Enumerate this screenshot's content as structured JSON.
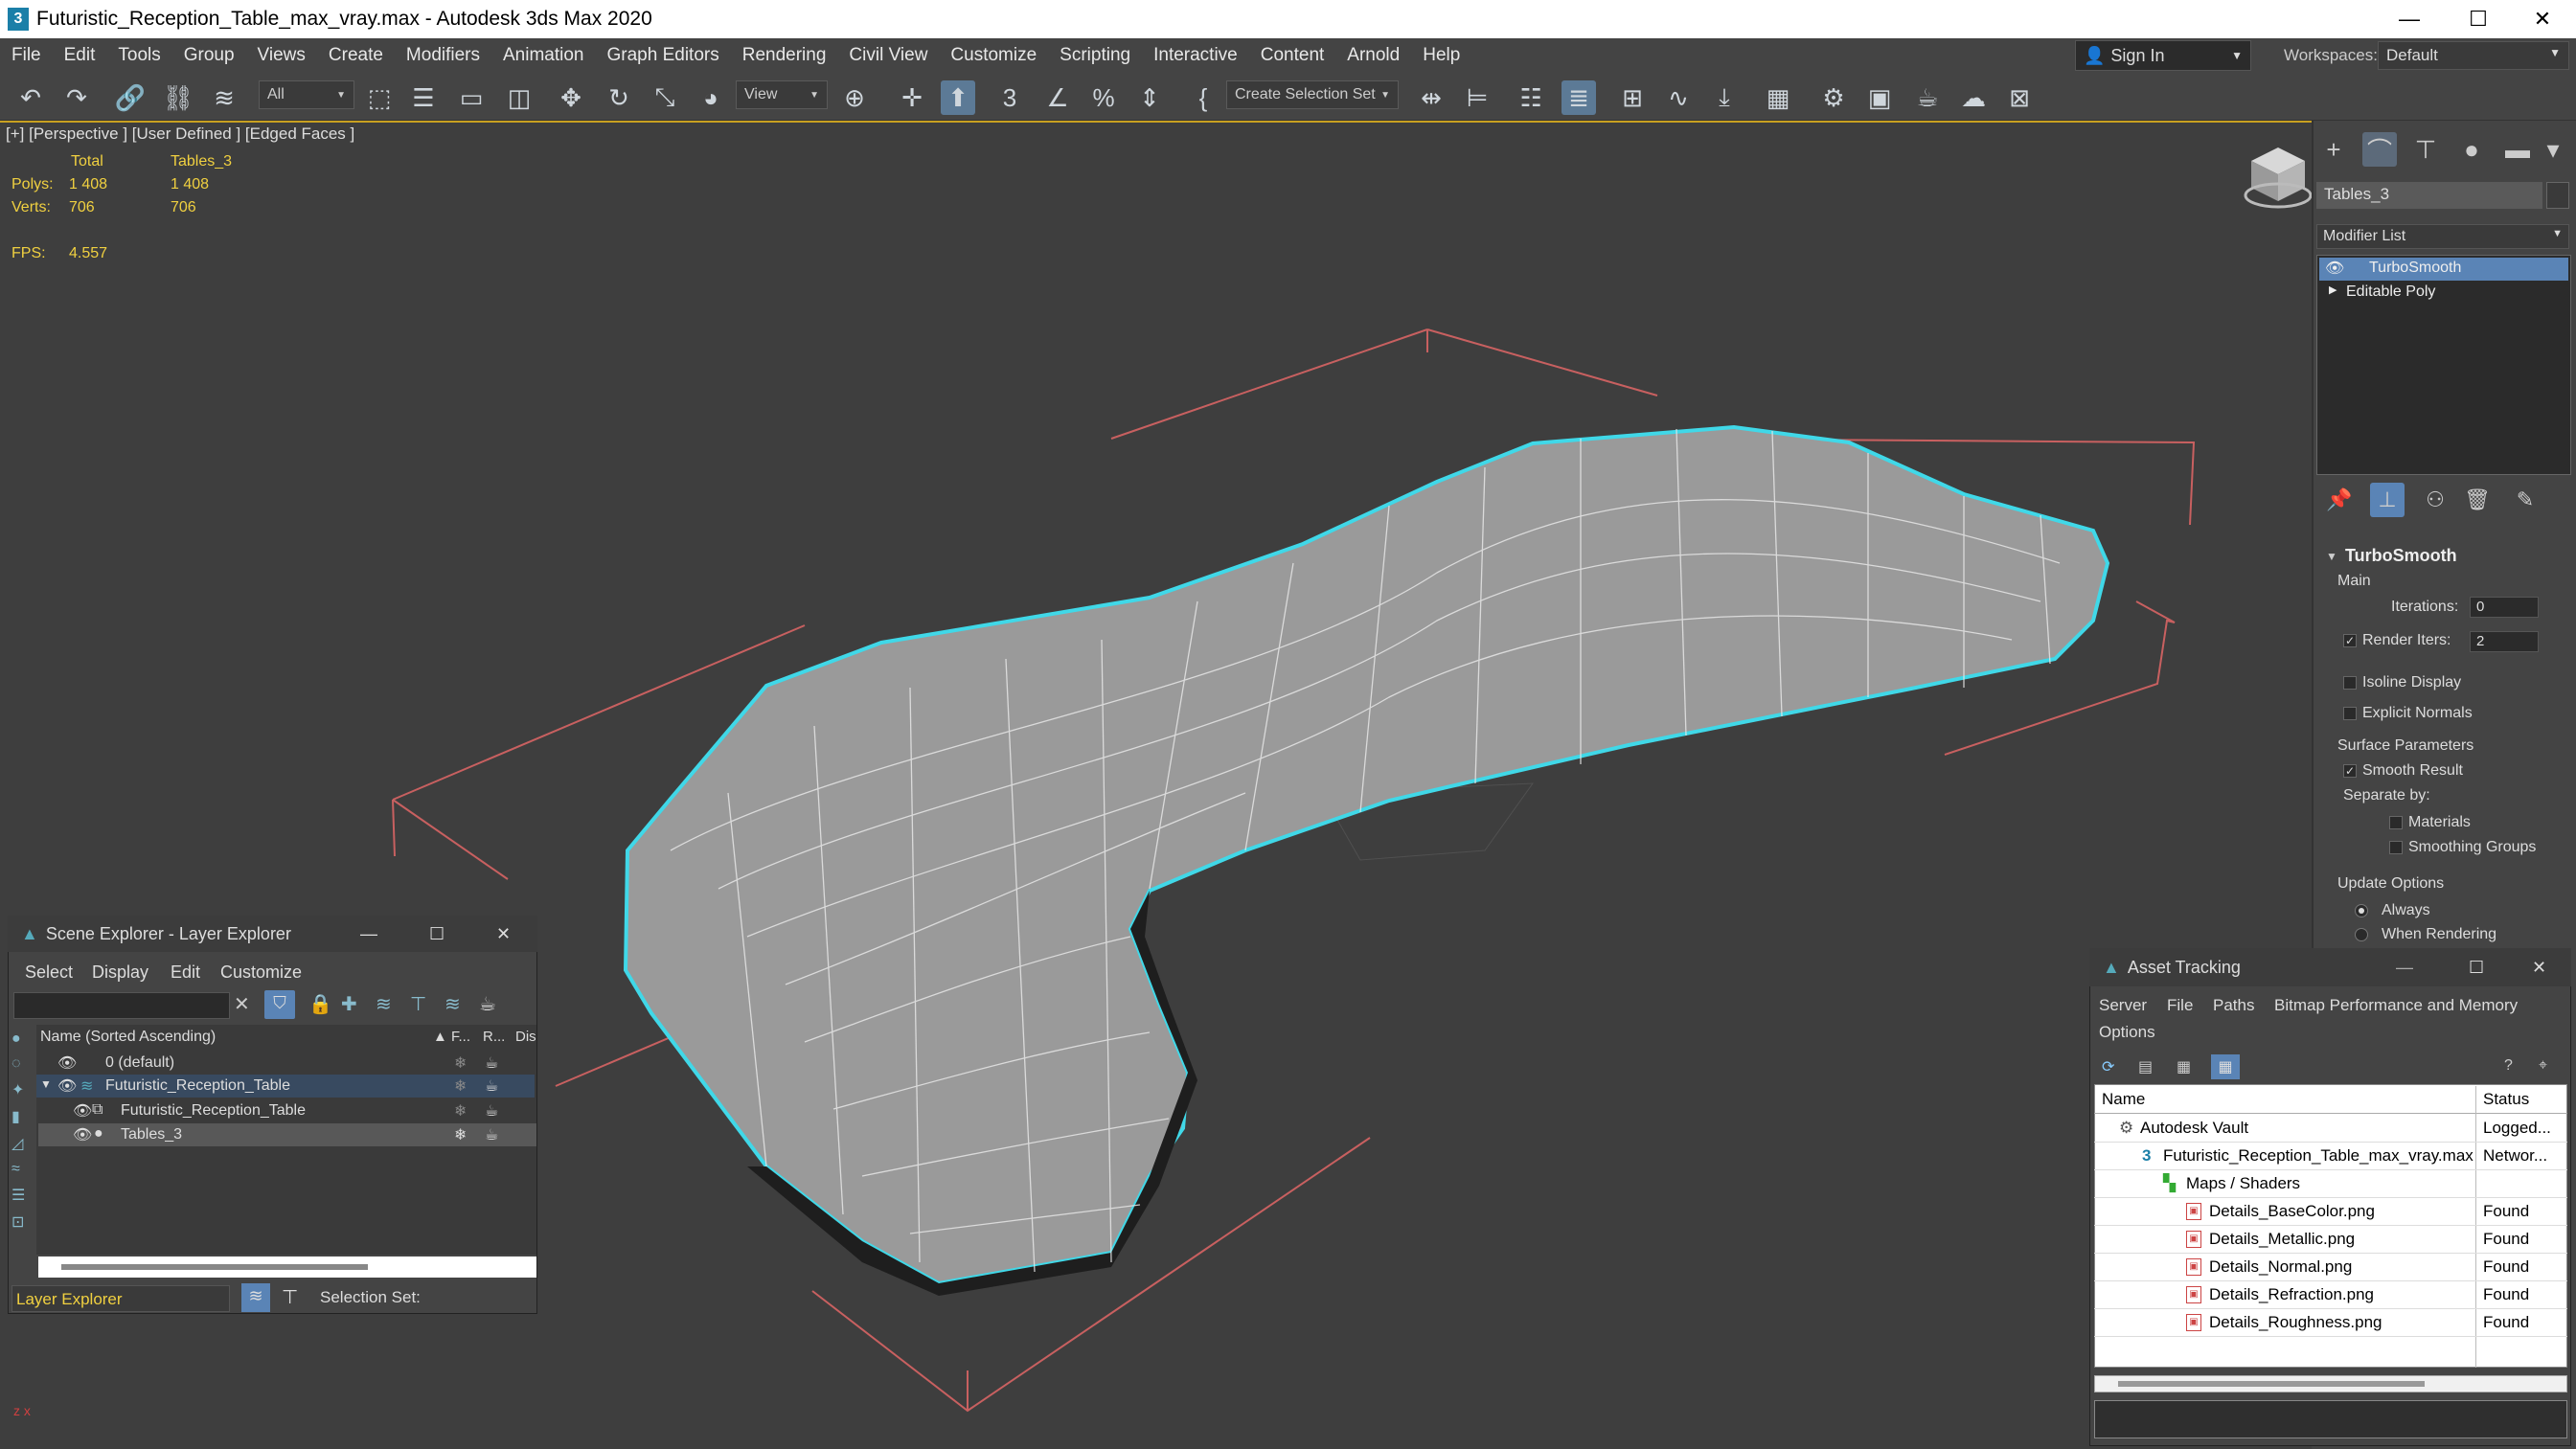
{
  "window": {
    "title": "Futuristic_Reception_Table_max_vray.max - Autodesk 3ds Max 2020",
    "app_icon": "3",
    "controls": [
      "—",
      "☐",
      "✕"
    ]
  },
  "menu": [
    "File",
    "Edit",
    "Tools",
    "Group",
    "Views",
    "Create",
    "Modifiers",
    "Animation",
    "Graph Editors",
    "Rendering",
    "Civil View",
    "Customize",
    "Scripting",
    "Interactive",
    "Content",
    "Arnold",
    "Help"
  ],
  "account": {
    "sign_in": "Sign In",
    "workspaces_label": "Workspaces:",
    "workspace": "Default"
  },
  "toolbar": {
    "filter": "All",
    "ref_coord": "View",
    "selection_set": "Create Selection Set"
  },
  "viewport": {
    "label": "[+] [Perspective ] [User Defined ] [Edged Faces ]",
    "stats": {
      "total_label": "Total",
      "object_label": "Tables_3",
      "polys_label": "Polys:",
      "polys_total": "1 408",
      "polys_obj": "1 408",
      "verts_label": "Verts:",
      "verts_total": "706",
      "verts_obj": "706",
      "fps_label": "FPS:",
      "fps": "4.557"
    },
    "selection_color": "#40d8e8",
    "accent": "#c8a020"
  },
  "command_panel": {
    "object_name": "Tables_3",
    "modifier_list": "Modifier List",
    "stack": [
      "TurboSmooth",
      "Editable Poly"
    ],
    "rollout": "TurboSmooth",
    "main_label": "Main",
    "iterations_label": "Iterations:",
    "iterations": "0",
    "render_iters_label": "Render Iters:",
    "render_iters": "2",
    "isoline": "Isoline Display",
    "explicit_normals": "Explicit Normals",
    "surface_params": "Surface Parameters",
    "smooth_result": "Smooth Result",
    "separate_by": "Separate by:",
    "materials": "Materials",
    "smoothing_groups": "Smoothing Groups",
    "update_options": "Update Options",
    "always": "Always",
    "when_rendering": "When Rendering"
  },
  "scene_explorer": {
    "title": "Scene Explorer - Layer Explorer",
    "menu": [
      "Select",
      "Display",
      "Edit",
      "Customize"
    ],
    "columns": {
      "name": "Name (Sorted Ascending)",
      "f": "▲ F...",
      "r": "R...",
      "dis": "Dis"
    },
    "rows": [
      "0 (default)",
      "Futuristic_Reception_Table",
      "Futuristic_Reception_Table",
      "Tables_3"
    ],
    "footer_mode": "Layer Explorer",
    "selection_set_label": "Selection Set:"
  },
  "asset_tracking": {
    "title": "Asset Tracking",
    "menu": [
      "Server",
      "File",
      "Paths",
      "Bitmap Performance and Memory",
      "Options"
    ],
    "columns": {
      "name": "Name",
      "status": "Status"
    },
    "rows": [
      {
        "name": "Autodesk Vault",
        "status": "Logged..."
      },
      {
        "name": "Futuristic_Reception_Table_max_vray.max",
        "status": "Networ..."
      },
      {
        "name": "Maps / Shaders",
        "status": ""
      },
      {
        "name": "Details_BaseColor.png",
        "status": "Found"
      },
      {
        "name": "Details_Metallic.png",
        "status": "Found"
      },
      {
        "name": "Details_Normal.png",
        "status": "Found"
      },
      {
        "name": "Details_Refraction.png",
        "status": "Found"
      },
      {
        "name": "Details_Roughness.png",
        "status": "Found"
      }
    ]
  }
}
